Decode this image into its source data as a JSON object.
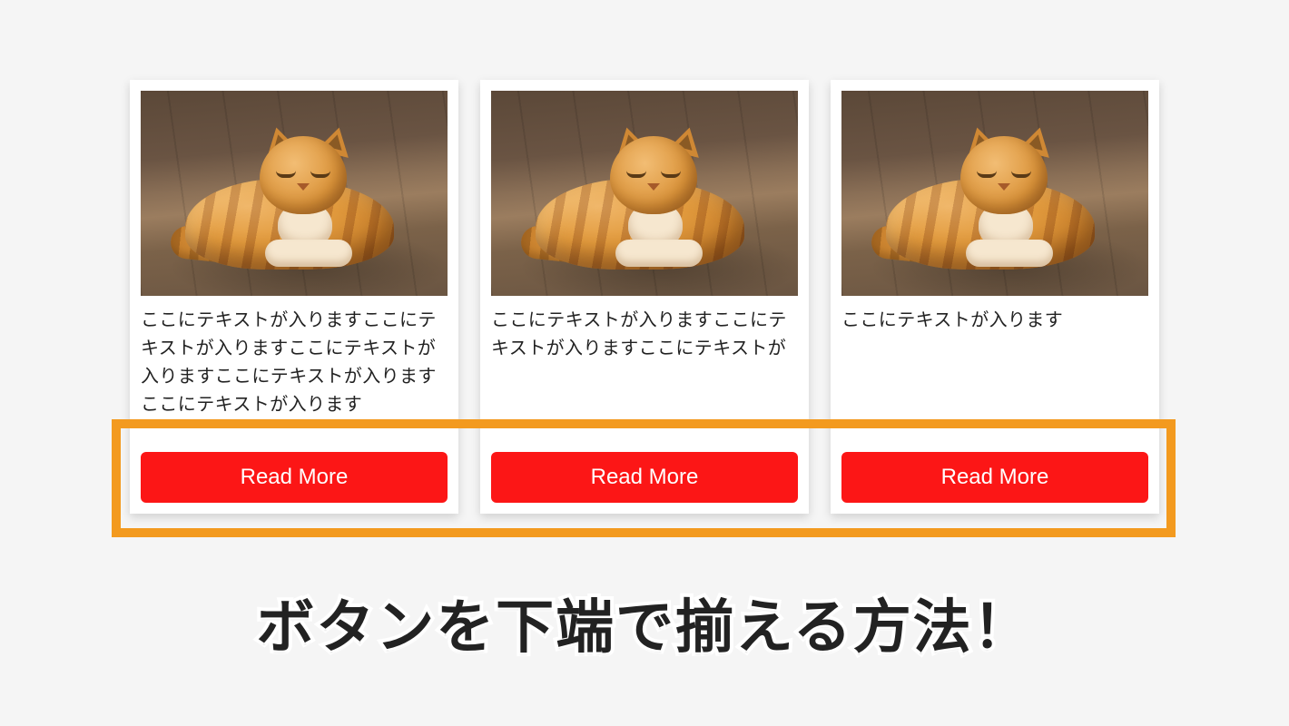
{
  "cards": [
    {
      "text": "ここにテキストが入りますここにテキストが入りますここにテキストが入りますここにテキストが入りますここにテキストが入ります",
      "button_label": "Read More"
    },
    {
      "text": "ここにテキストが入りますここにテキストが入りますここにテキストが",
      "button_label": "Read More"
    },
    {
      "text": "ここにテキストが入ります",
      "button_label": "Read More"
    }
  ],
  "headline": "ボタンを下端で揃える方法！",
  "colors": {
    "button_bg": "#fc1616",
    "highlight_border": "#f39a1f"
  }
}
